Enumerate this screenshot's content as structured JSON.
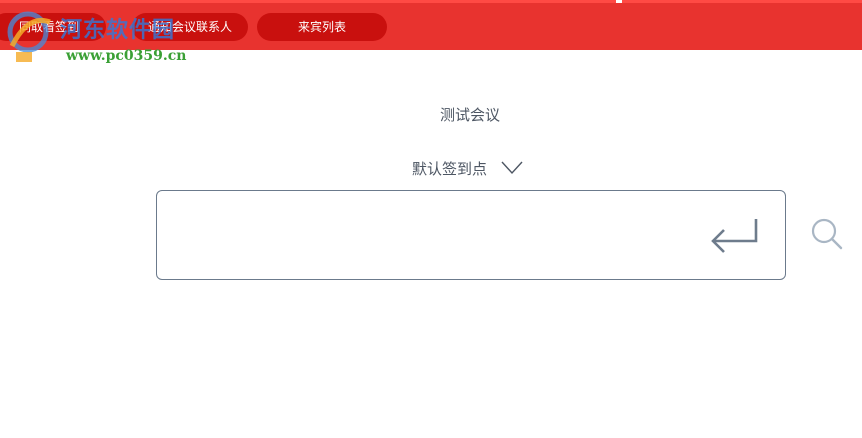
{
  "nav": {
    "tabs": [
      {
        "label": "同取看签到"
      },
      {
        "label": "通知会议联系人"
      },
      {
        "label": "来宾列表"
      }
    ]
  },
  "watermark": {
    "cn_text": "河东软件园",
    "url": "www.pc0359.cn",
    "icon": "hedong-logo-icon"
  },
  "meeting": {
    "title": "测试会议"
  },
  "signin_point": {
    "selected": "默认签到点",
    "icon": "chevron-down-icon"
  },
  "search": {
    "value": "",
    "placeholder": "",
    "enter_icon": "enter-return-icon",
    "search_icon": "search-icon"
  },
  "colors": {
    "header_bg": "#e8332f",
    "tab_bg": "#c9100e",
    "text": "#4d5663",
    "border": "#6b7a8c",
    "icon_gray": "#6e7c8c",
    "search_icon_gray": "#a9b6c4"
  }
}
